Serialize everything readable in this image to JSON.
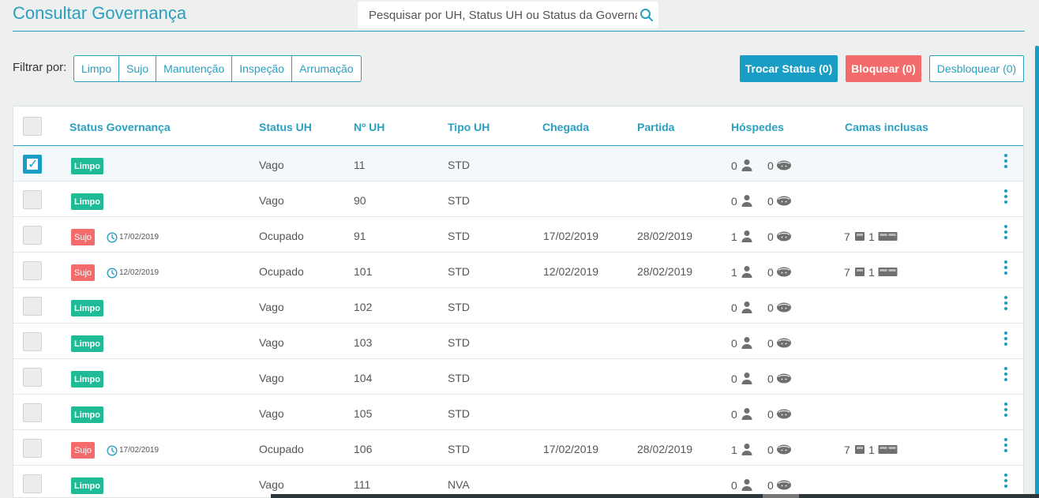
{
  "page": {
    "title": "Consultar Governança"
  },
  "search": {
    "placeholder": "Pesquisar por UH, Status UH ou Status da Governança"
  },
  "filter": {
    "label": "Filtrar por:",
    "options": [
      "Limpo",
      "Sujo",
      "Manutenção",
      "Inspeção",
      "Arrumação"
    ]
  },
  "actions": {
    "trocar": "Trocar Status (0)",
    "bloquear": "Bloquear (0)",
    "desbloquear": "Desbloquear (0)"
  },
  "table": {
    "headers": [
      "Status Governança",
      "Status UH",
      "Nº UH",
      "Tipo UH",
      "Chegada",
      "Partida",
      "Hóspedes",
      "Camas inclusas"
    ],
    "rows": [
      {
        "checked": true,
        "status": "Limpo",
        "date": "",
        "uh_status": "Vago",
        "uh": "11",
        "tipo": "STD",
        "chegada": "",
        "partida": "",
        "adults": "0",
        "children": "0",
        "single_beds": "",
        "double_beds": ""
      },
      {
        "checked": false,
        "status": "Limpo",
        "date": "",
        "uh_status": "Vago",
        "uh": "90",
        "tipo": "STD",
        "chegada": "",
        "partida": "",
        "adults": "0",
        "children": "0",
        "single_beds": "",
        "double_beds": ""
      },
      {
        "checked": false,
        "status": "Sujo",
        "date": "17/02/2019",
        "uh_status": "Ocupado",
        "uh": "91",
        "tipo": "STD",
        "chegada": "17/02/2019",
        "partida": "28/02/2019",
        "adults": "1",
        "children": "0",
        "single_beds": "7",
        "double_beds": "1"
      },
      {
        "checked": false,
        "status": "Sujo",
        "date": "12/02/2019",
        "uh_status": "Ocupado",
        "uh": "101",
        "tipo": "STD",
        "chegada": "12/02/2019",
        "partida": "28/02/2019",
        "adults": "1",
        "children": "0",
        "single_beds": "7",
        "double_beds": "1"
      },
      {
        "checked": false,
        "status": "Limpo",
        "date": "",
        "uh_status": "Vago",
        "uh": "102",
        "tipo": "STD",
        "chegada": "",
        "partida": "",
        "adults": "0",
        "children": "0",
        "single_beds": "",
        "double_beds": ""
      },
      {
        "checked": false,
        "status": "Limpo",
        "date": "",
        "uh_status": "Vago",
        "uh": "103",
        "tipo": "STD",
        "chegada": "",
        "partida": "",
        "adults": "0",
        "children": "0",
        "single_beds": "",
        "double_beds": ""
      },
      {
        "checked": false,
        "status": "Limpo",
        "date": "",
        "uh_status": "Vago",
        "uh": "104",
        "tipo": "STD",
        "chegada": "",
        "partida": "",
        "adults": "0",
        "children": "0",
        "single_beds": "",
        "double_beds": ""
      },
      {
        "checked": false,
        "status": "Limpo",
        "date": "",
        "uh_status": "Vago",
        "uh": "105",
        "tipo": "STD",
        "chegada": "",
        "partida": "",
        "adults": "0",
        "children": "0",
        "single_beds": "",
        "double_beds": ""
      },
      {
        "checked": false,
        "status": "Sujo",
        "date": "17/02/2019",
        "uh_status": "Ocupado",
        "uh": "106",
        "tipo": "STD",
        "chegada": "17/02/2019",
        "partida": "28/02/2019",
        "adults": "1",
        "children": "0",
        "single_beds": "7",
        "double_beds": "1"
      },
      {
        "checked": false,
        "status": "Limpo",
        "date": "",
        "uh_status": "Vago",
        "uh": "111",
        "tipo": "NVA",
        "chegada": "",
        "partida": "",
        "adults": "0",
        "children": "0",
        "single_beds": "",
        "double_beds": ""
      }
    ]
  },
  "colors": {
    "accent": "#1a9dc4",
    "clean": "#1fbb96",
    "dirty": "#f36b6b",
    "icon": "#6f6f6f"
  },
  "icons": {
    "search": "search-icon",
    "clock": "clock-icon",
    "adult": "person-icon",
    "child": "baby-icon",
    "single_bed": "single-bed-icon",
    "double_bed": "double-bed-icon",
    "more": "kebab-menu-icon"
  }
}
